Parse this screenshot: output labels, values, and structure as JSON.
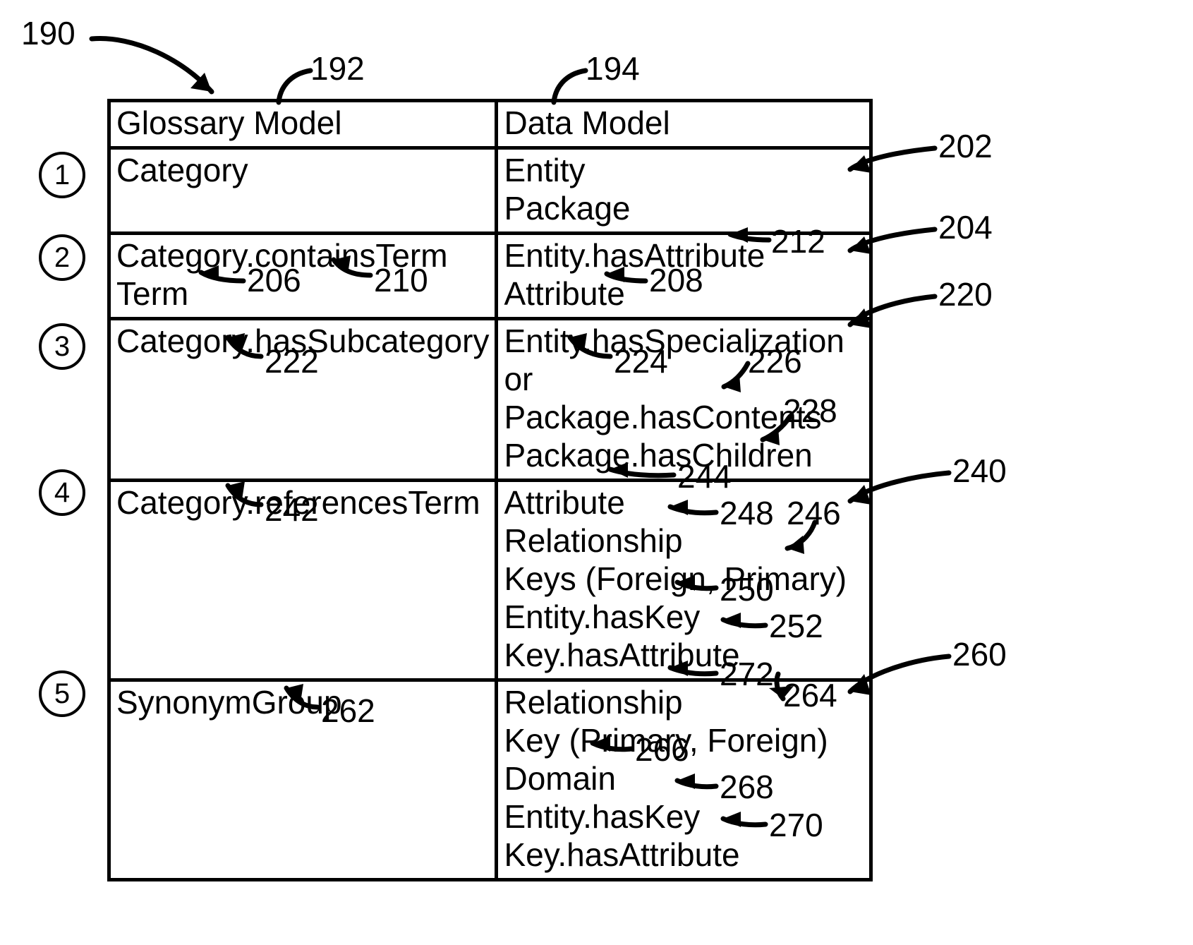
{
  "figure_ref_main": "190",
  "col_ref_left": "192",
  "col_ref_right": "194",
  "header": {
    "left": "Glossary Model",
    "right": "Data Model"
  },
  "rows": [
    {
      "num": "1",
      "left": "Category",
      "right_l1": "Entity",
      "right_l2": "Package",
      "ref_right": "202"
    },
    {
      "num": "2",
      "left_l1": "Category.containsTerm",
      "left_l2": "Term",
      "right_l1": "Entity.hasAttribute",
      "right_l2": "Attribute",
      "ref_right": "204",
      "ref_206": "206",
      "ref_208": "208",
      "ref_210": "210",
      "ref_212": "212"
    },
    {
      "num": "3",
      "left_l1": "Category.hasSubcategory",
      "right_l1": "Entity.hasSpecialization",
      "right_l2": "or",
      "right_l3": "Package.hasContents",
      "right_l4": "Package.hasChildren",
      "ref_right": "220",
      "ref_222": "222",
      "ref_224": "224",
      "ref_226": "226",
      "ref_228": "228"
    },
    {
      "num": "4",
      "left_l1": "Category.referencesTerm",
      "right_l1": "Attribute",
      "right_l2": "Relationship",
      "right_l3": "Keys (Foreign, Primary)",
      "right_l4": "Entity.hasKey",
      "right_l5": "Key.hasAttribute",
      "ref_right": "240",
      "ref_242": "242",
      "ref_244": "244",
      "ref_246": "246",
      "ref_248": "248",
      "ref_250": "250",
      "ref_252": "252"
    },
    {
      "num": "5",
      "left_l1": "SynonymGroup",
      "right_l1": "Relationship",
      "right_l2": "Key (Primary, Foreign)",
      "right_l3": "Domain",
      "right_l4": "Entity.hasKey",
      "right_l5": "Key.hasAttribute",
      "ref_right": "260",
      "ref_262": "262",
      "ref_264": "264",
      "ref_266": "266",
      "ref_268": "268",
      "ref_270": "270",
      "ref_272": "272"
    }
  ]
}
